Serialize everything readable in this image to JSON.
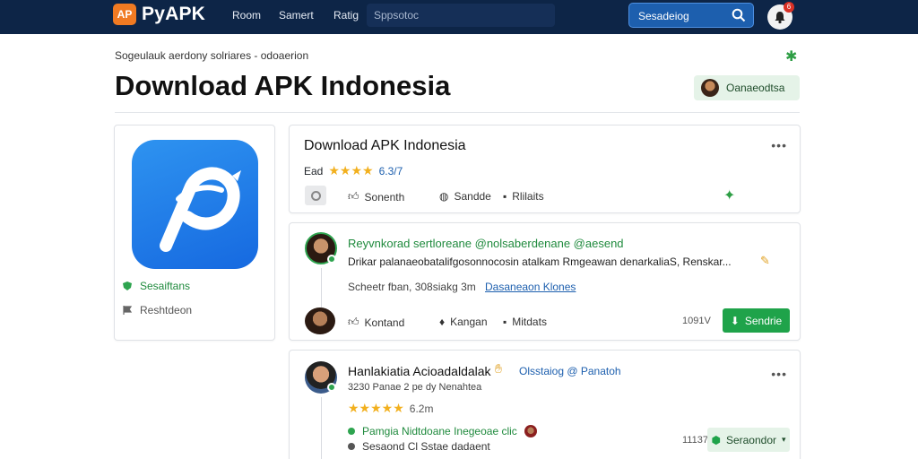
{
  "topbar": {
    "logo_mark": "AP",
    "logo_text": "PyAPK",
    "nav": [
      "Room",
      "Samert",
      "Ratig"
    ],
    "search_placeholder": "Sppsotoc",
    "search_button": "Sesadeiog",
    "notification_count": "6"
  },
  "header": {
    "breadcrumb": "Sogeulauk aerdony solriares  -  odoaerion",
    "title": "Download APK Indonesia",
    "pill_label": "Oanaeodtsa"
  },
  "app_card": {
    "row1": "Sesaiftans",
    "row2": "Reshtdeon"
  },
  "post1": {
    "title": "Download APK Indonesia",
    "rating_prefix": "Ead",
    "rating_value": "6.3/7",
    "actions": [
      "Sonenth",
      "Sandde",
      "Rlilaits"
    ]
  },
  "post2": {
    "author_line": "Reyvnkorad sertloreane @nolsaberdenane @aesend",
    "body": "Drikar palanaeobatalifgosonnocosin atalkam Rmgeawan denarkaliaS, Renskar...",
    "meta": "Scheetr fban, 308siakg 3m",
    "link": "Dasaneaon Klones",
    "actions": [
      "Kontand",
      "Kangan",
      "Mitdats"
    ],
    "count": "1091V",
    "button": "Sendrie"
  },
  "post3": {
    "author": "Hanlakiatia Acioadaldalak",
    "tag": "Olsstaiog @ Panatoh",
    "sub": "3230 Panae 2 pe dy Nenahtea",
    "rating": "6.2m",
    "line1": "Pamgia Nidtdoane Inegeoae clic",
    "line2": "Sesaond Cl Sstae dadaent",
    "count": "11137",
    "button": "Seraondor"
  },
  "colors": {
    "topbar": "#0d2547",
    "accent_blue": "#1d5fae",
    "green": "#1fa34a",
    "star": "#f2b01e",
    "logo_orange": "#f07a22"
  },
  "icons": [
    "logo-icon",
    "search-icon",
    "bell-icon",
    "star-icon",
    "like-icon",
    "comment-icon",
    "share-icon",
    "pin-icon",
    "shield-icon"
  ]
}
